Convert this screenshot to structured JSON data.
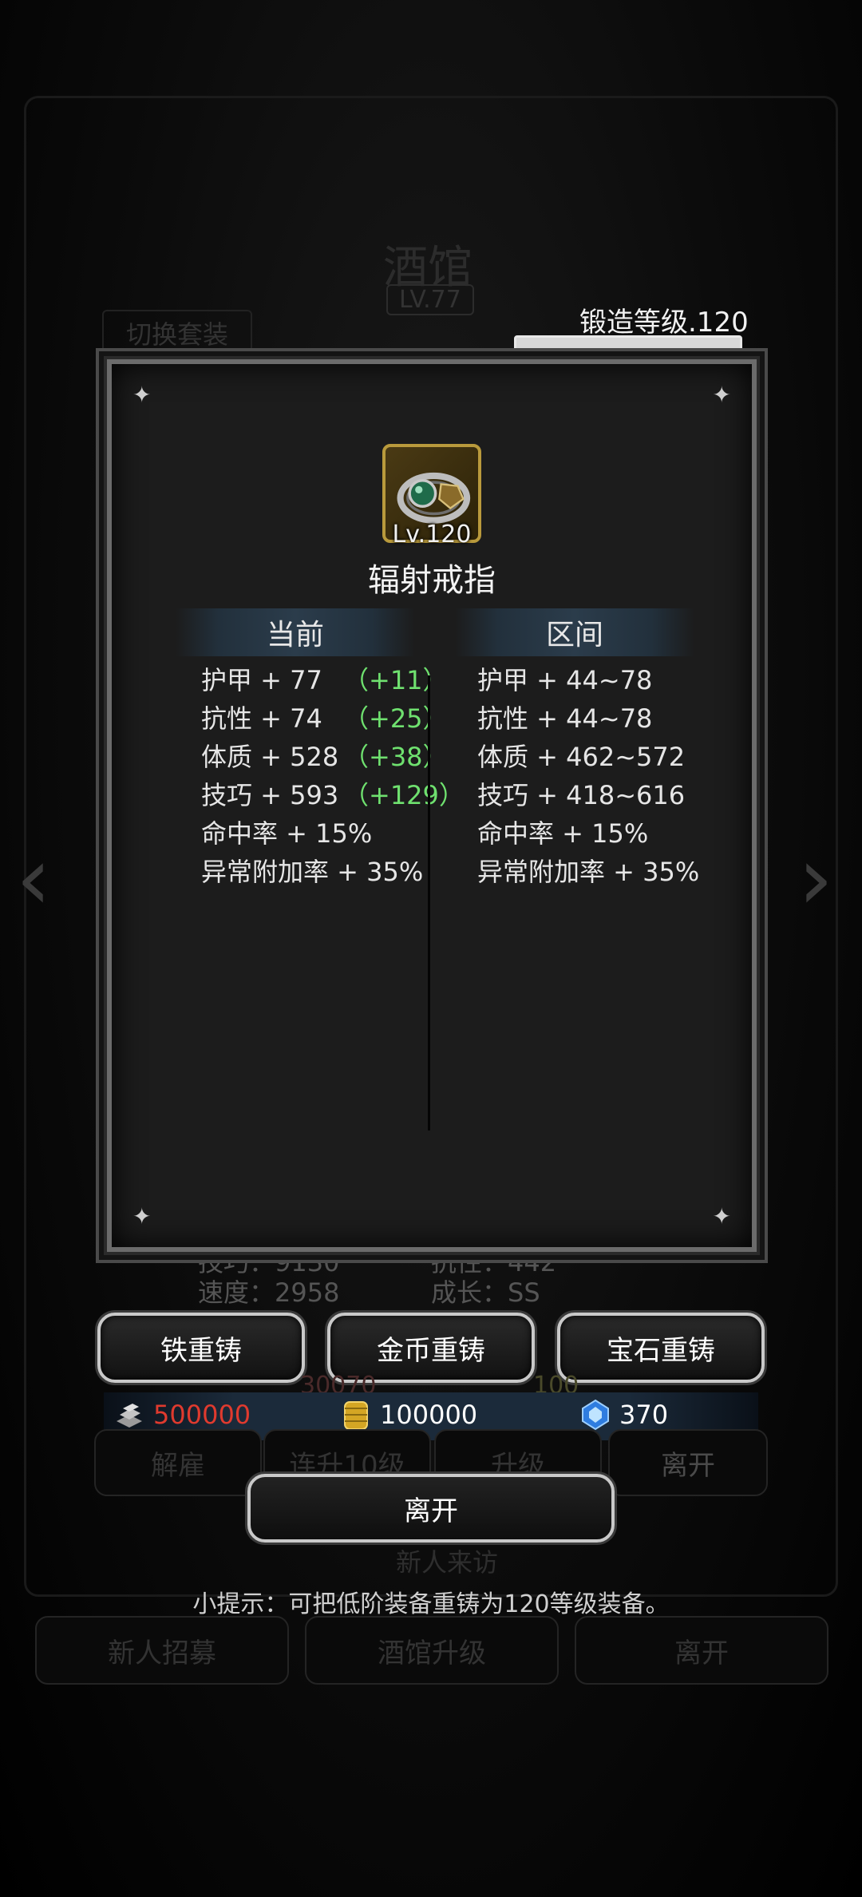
{
  "background": {
    "title": "酒馆",
    "level": "LV.77",
    "swap_outfit": "切换套装",
    "stats": {
      "dex": "技巧：9130",
      "res": "抗性：442",
      "speed": "速度：2958",
      "growth": "成长：SS"
    },
    "cost_left": "30070",
    "cost_right": "100",
    "buttons": {
      "dismiss": "解雇",
      "level10": "连升10级",
      "upgrade": "升级",
      "leave": "离开"
    },
    "new_visitor": "新人来访",
    "bottom_buttons": {
      "recruit": "新人招募",
      "tavern_upgrade": "酒馆升级",
      "leave": "离开"
    }
  },
  "forge": {
    "label": "锻造等级.120",
    "progress": 1.0
  },
  "item": {
    "level": "Lv.120",
    "name": "辐射戒指",
    "icon": "ring-icon"
  },
  "columns": {
    "current": "当前",
    "range": "区间"
  },
  "current_stats": [
    {
      "label": "护甲 + 77",
      "bonus": "（+11）"
    },
    {
      "label": "抗性 + 74",
      "bonus": "（+25）"
    },
    {
      "label": "体质 + 528",
      "bonus": "（+38）"
    },
    {
      "label": "技巧 + 593",
      "bonus": "（+129）"
    },
    {
      "label": "命中率 + 15%",
      "bonus": ""
    },
    {
      "label": "异常附加率 + 35%",
      "bonus": ""
    }
  ],
  "range_stats": [
    "护甲 + 44~78",
    "抗性 + 44~78",
    "体质 + 462~572",
    "技巧 + 418~616",
    "命中率 + 15%",
    "异常附加率 + 35%"
  ],
  "reforge_buttons": {
    "iron": "铁重铸",
    "gold": "金币重铸",
    "gem": "宝石重铸"
  },
  "currency": {
    "iron": "500000",
    "gold": "100000",
    "gem": "370",
    "iron_color": "#e03a2e",
    "gold_color": "#ffffff",
    "gem_color": "#ffffff"
  },
  "leave_label": "离开",
  "tip": "小提示：可把低阶装备重铸为120等级装备。"
}
